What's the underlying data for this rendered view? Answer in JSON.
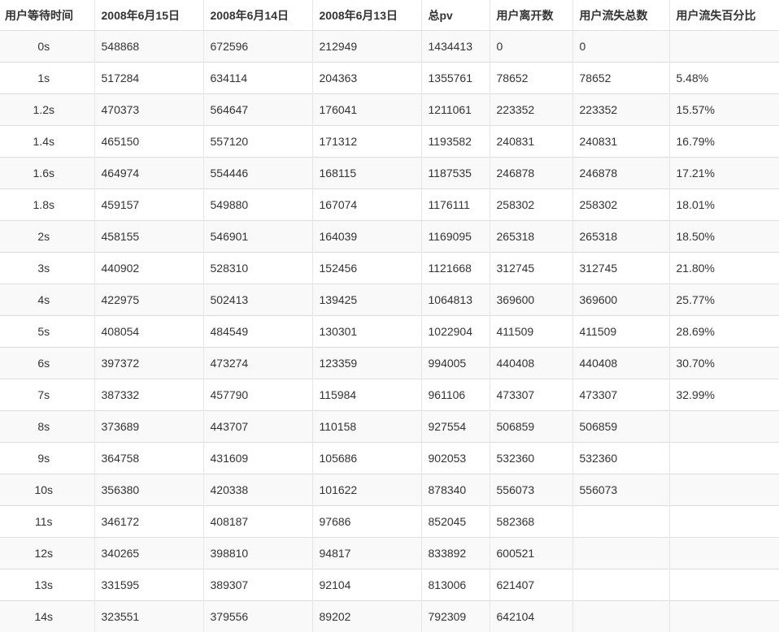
{
  "table": {
    "headers": [
      "用户等待时间",
      "2008年6月15日",
      "2008年6月14日",
      "2008年6月13日",
      "总pv",
      "用户离开数",
      "用户流失总数",
      "用户流失百分比"
    ],
    "rows": [
      [
        "0s",
        "548868",
        "672596",
        "212949",
        "1434413",
        "0",
        "0",
        ""
      ],
      [
        "1s",
        "517284",
        "634114",
        "204363",
        "1355761",
        "78652",
        "78652",
        "5.48%"
      ],
      [
        "1.2s",
        "470373",
        "564647",
        "176041",
        "1211061",
        "223352",
        "223352",
        "15.57%"
      ],
      [
        "1.4s",
        "465150",
        "557120",
        "171312",
        "1193582",
        "240831",
        "240831",
        "16.79%"
      ],
      [
        "1.6s",
        "464974",
        "554446",
        "168115",
        "1187535",
        "246878",
        "246878",
        "17.21%"
      ],
      [
        "1.8s",
        "459157",
        "549880",
        "167074",
        "1176111",
        "258302",
        "258302",
        "18.01%"
      ],
      [
        "2s",
        "458155",
        "546901",
        "164039",
        "1169095",
        "265318",
        "265318",
        "18.50%"
      ],
      [
        "3s",
        "440902",
        "528310",
        "152456",
        "1121668",
        "312745",
        "312745",
        "21.80%"
      ],
      [
        "4s",
        "422975",
        "502413",
        "139425",
        "1064813",
        "369600",
        "369600",
        "25.77%"
      ],
      [
        "5s",
        "408054",
        "484549",
        "130301",
        "1022904",
        "411509",
        "411509",
        "28.69%"
      ],
      [
        "6s",
        "397372",
        "473274",
        "123359",
        "994005",
        "440408",
        "440408",
        "30.70%"
      ],
      [
        "7s",
        "387332",
        "457790",
        "115984",
        "961106",
        "473307",
        "473307",
        "32.99%"
      ],
      [
        "8s",
        "373689",
        "443707",
        "110158",
        "927554",
        "506859",
        "506859",
        ""
      ],
      [
        "9s",
        "364758",
        "431609",
        "105686",
        "902053",
        "532360",
        "532360",
        ""
      ],
      [
        "10s",
        "356380",
        "420338",
        "101622",
        "878340",
        "556073",
        "556073",
        ""
      ],
      [
        "11s",
        "346172",
        "408187",
        "97686",
        "852045",
        "582368",
        "",
        ""
      ],
      [
        "12s",
        "340265",
        "398810",
        "94817",
        "833892",
        "600521",
        "",
        ""
      ],
      [
        "13s",
        "331595",
        "389307",
        "92104",
        "813006",
        "621407",
        "",
        ""
      ],
      [
        "14s",
        "323551",
        "379556",
        "89202",
        "792309",
        "642104",
        "",
        ""
      ]
    ]
  }
}
